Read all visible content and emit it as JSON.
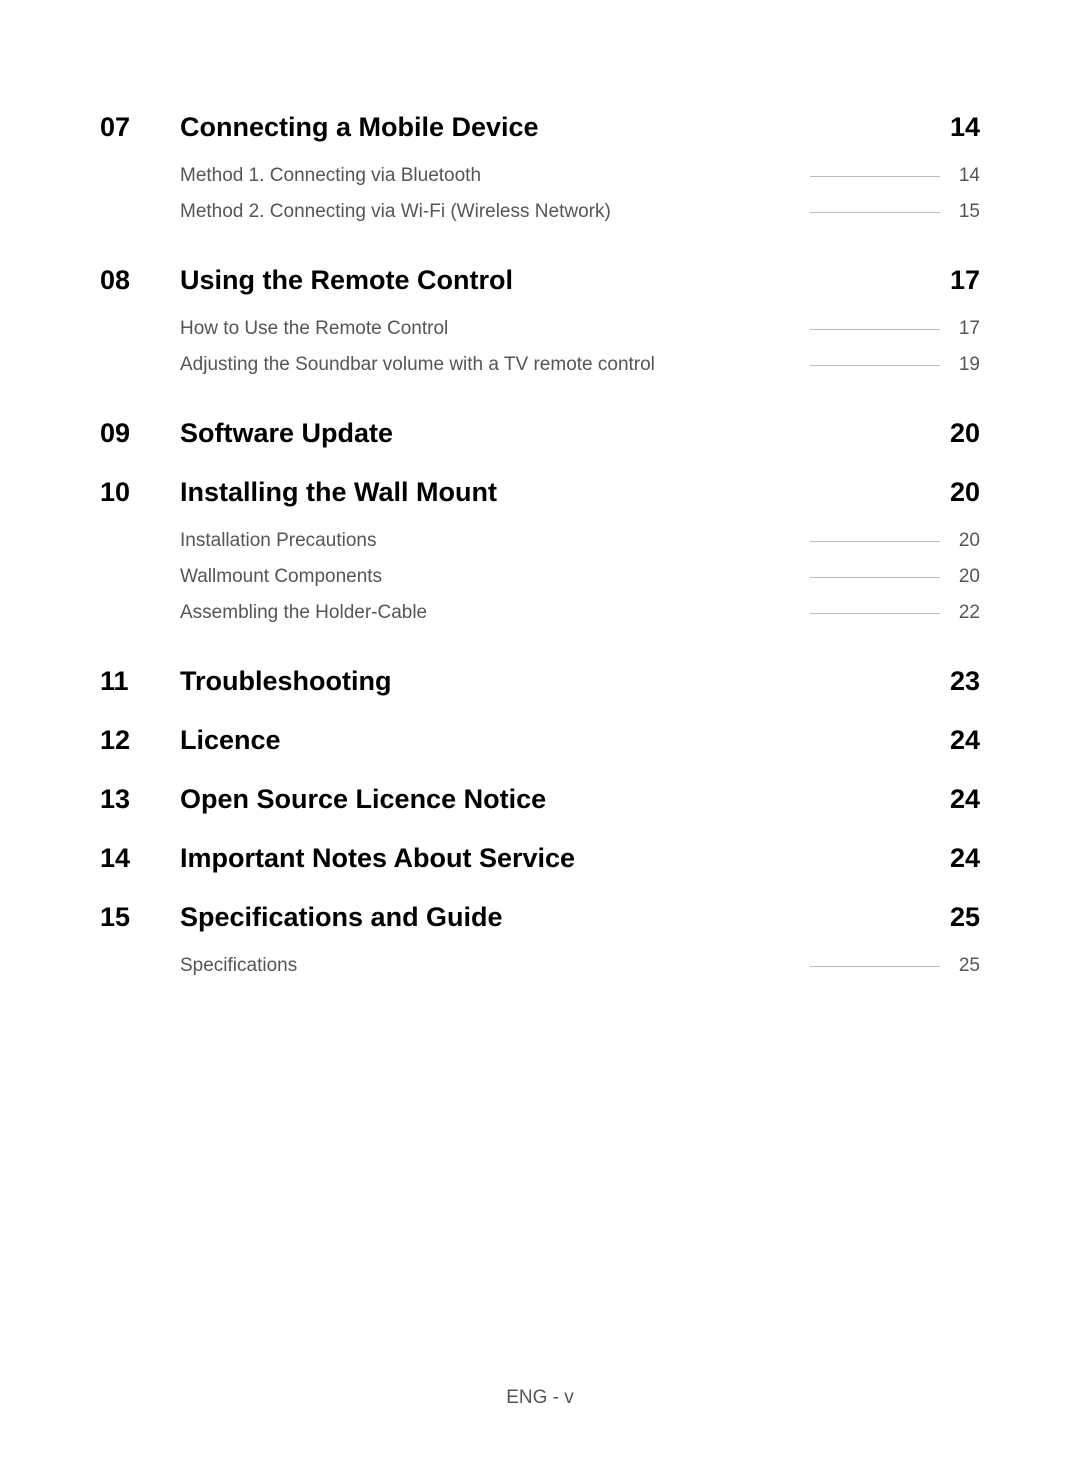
{
  "toc": [
    {
      "number": "07",
      "title": "Connecting a Mobile Device",
      "page": "14",
      "subs": [
        {
          "title": "Method 1. Connecting via Bluetooth",
          "page": "14"
        },
        {
          "title": "Method 2. Connecting via Wi-Fi (Wireless Network)",
          "page": "15"
        }
      ]
    },
    {
      "number": "08",
      "title": "Using the Remote Control",
      "page": "17",
      "subs": [
        {
          "title": "How to Use the Remote Control",
          "page": "17"
        },
        {
          "title": "Adjusting the Soundbar volume with a TV remote control",
          "page": "19"
        }
      ]
    },
    {
      "number": "09",
      "title": "Software Update",
      "page": "20",
      "subs": []
    },
    {
      "number": "10",
      "title": "Installing the Wall Mount",
      "page": "20",
      "subs": [
        {
          "title": "Installation Precautions",
          "page": "20"
        },
        {
          "title": "Wallmount Components",
          "page": "20"
        },
        {
          "title": "Assembling the Holder-Cable",
          "page": "22"
        }
      ]
    },
    {
      "number": "11",
      "title": "Troubleshooting",
      "page": "23",
      "subs": []
    },
    {
      "number": "12",
      "title": "Licence",
      "page": "24",
      "subs": []
    },
    {
      "number": "13",
      "title": "Open Source Licence Notice",
      "page": "24",
      "subs": []
    },
    {
      "number": "14",
      "title": "Important Notes About Service",
      "page": "24",
      "subs": []
    },
    {
      "number": "15",
      "title": "Specifications and Guide",
      "page": "25",
      "subs": [
        {
          "title": "Specifications",
          "page": "25"
        }
      ]
    }
  ],
  "footer": "ENG - v"
}
